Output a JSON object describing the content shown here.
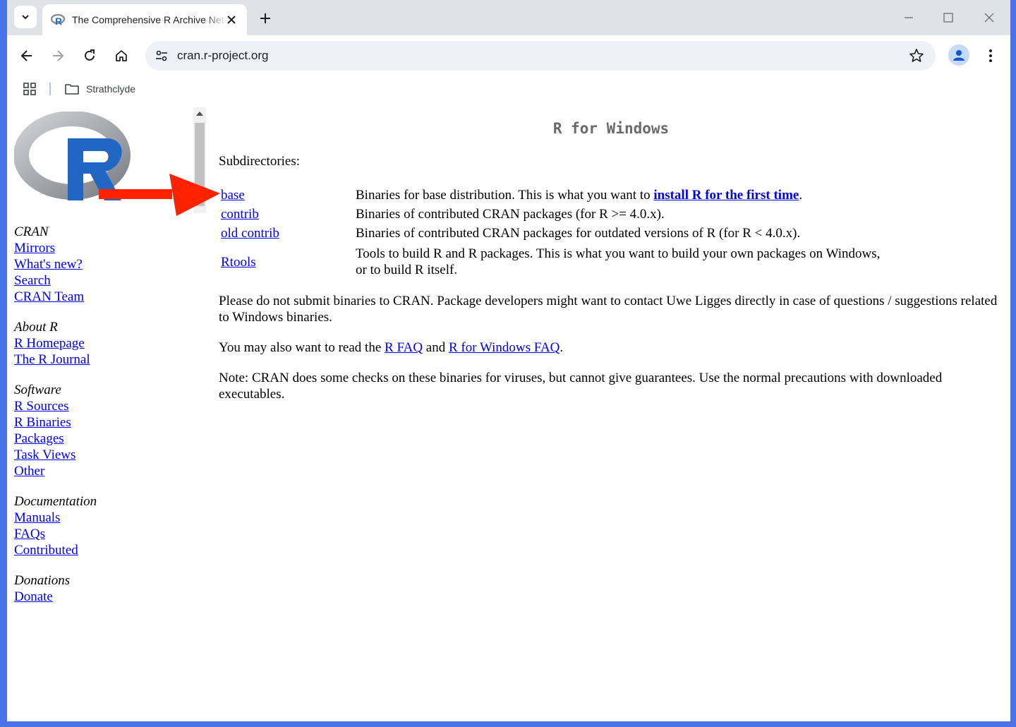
{
  "browser": {
    "tab_title": "The Comprehensive R Archive Network",
    "url": "cran.r-project.org",
    "bookmark_folder": "Strathclyde"
  },
  "sidebar": {
    "groups": [
      {
        "heading": "CRAN",
        "links": [
          "Mirrors",
          "What's new?",
          "Search",
          "CRAN Team"
        ]
      },
      {
        "heading": "About R",
        "links": [
          "R Homepage",
          "The R Journal"
        ]
      },
      {
        "heading": "Software",
        "links": [
          "R Sources",
          "R Binaries",
          "Packages",
          "Task Views",
          "Other"
        ]
      },
      {
        "heading": "Documentation",
        "links": [
          "Manuals",
          "FAQs",
          "Contributed"
        ]
      },
      {
        "heading": "Donations",
        "links": [
          "Donate"
        ]
      }
    ]
  },
  "main": {
    "title": "R for Windows",
    "subdirectories_label": "Subdirectories:",
    "rows": [
      {
        "name": "base",
        "desc_before": "Binaries for base distribution. This is what you want to ",
        "desc_link": "install R for the first time",
        "desc_after": "."
      },
      {
        "name": "contrib",
        "desc": "Binaries of contributed CRAN packages (for R >= 4.0.x)."
      },
      {
        "name": "old contrib",
        "desc": "Binaries of contributed CRAN packages for outdated versions of R (for R < 4.0.x)."
      },
      {
        "name": "Rtools",
        "desc_line1": "Tools to build R and R packages. This is what you want to build your own packages on Windows,",
        "desc_line2": "or to build R itself."
      }
    ],
    "para1": "Please do not submit binaries to CRAN. Package developers might want to contact Uwe Ligges directly in case of questions / suggestions related to Windows binaries.",
    "para2_before": "You may also want to read the ",
    "para2_link1": "R FAQ",
    "para2_mid": " and ",
    "para2_link2": "R for Windows FAQ",
    "para2_after": ".",
    "para3": "Note: CRAN does some checks on these binaries for viruses, but cannot give guarantees. Use the normal precautions with downloaded executables."
  },
  "colors": {
    "link": "#0000ee",
    "annotation_arrow": "#ff2200",
    "window_frame": "#4a73e8"
  }
}
